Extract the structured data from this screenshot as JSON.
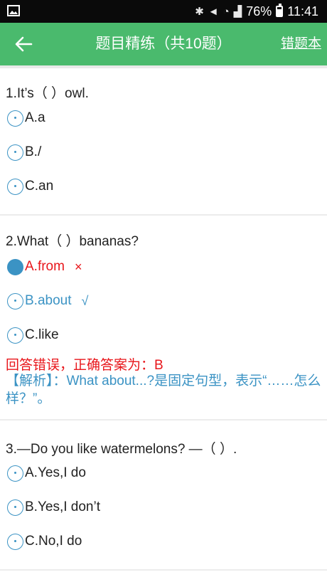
{
  "status_bar": {
    "battery": "76%",
    "time": "11:41"
  },
  "header": {
    "title": "题目精练（共10题）",
    "wrong_book": "错题本"
  },
  "questions": [
    {
      "text": "1.It’s（ ）owl.",
      "options": [
        "A.a",
        "B./",
        "C.an"
      ]
    },
    {
      "text": "2.What（ ）bananas?",
      "options": [
        "A.from",
        "B.about",
        "C.like"
      ],
      "wrong_mark": "×",
      "correct_mark": "√",
      "result": "回答错误，正确答案为：B",
      "analysis": "【解析】：What about...?是固定句型，表示“……怎么样？”。"
    },
    {
      "text": "3.—Do you like watermelons? —（ ）.",
      "options": [
        "A.Yes,I do",
        "B.Yes,I don’t",
        "C.No,I do"
      ]
    }
  ],
  "colors": {
    "header_green": "#4aba6d",
    "wrong_red": "#e8161b",
    "correct_blue": "#3b93c4"
  },
  "icons": {
    "status_left": "gallery-icon",
    "back": "arrow-left-icon",
    "option_radio": "radio-icon"
  }
}
